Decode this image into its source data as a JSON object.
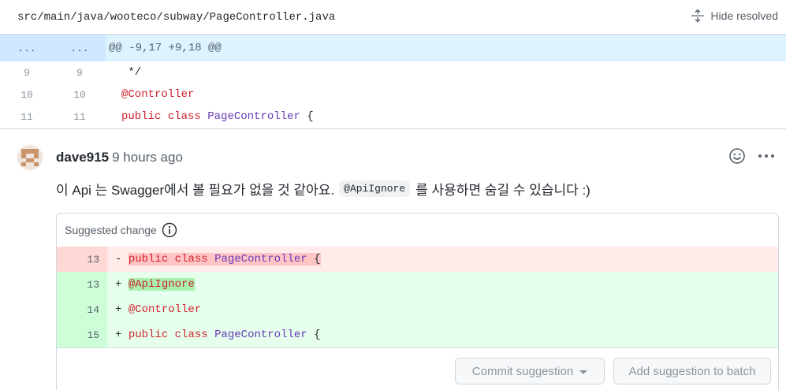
{
  "file": {
    "path": "src/main/java/wooteco/subway/PageController.java",
    "hide_resolved_label": "Hide resolved"
  },
  "diff": {
    "hunk": {
      "left": "...",
      "right": "...",
      "header": "@@ -9,17 +9,18 @@"
    },
    "lines": [
      {
        "old": "9",
        "new": "9",
        "code": " */"
      },
      {
        "old": "10",
        "new": "10",
        "code_ann": "@Controller"
      },
      {
        "old": "11",
        "new": "11",
        "kw1": "public",
        "kw2": "class",
        "cls": "PageController",
        "rest": " {"
      }
    ]
  },
  "comment": {
    "author": "dave915",
    "time": "9 hours ago",
    "text_before": "이 Api 는 Swagger에서 볼 필요가 없을 것 같아요.",
    "inline_code": "@ApiIgnore",
    "text_after": "를 사용하면 숨길 수 있습니다 :)"
  },
  "suggestion": {
    "title": "Suggested change",
    "rows": [
      {
        "type": "del",
        "num": "13",
        "sign": "-",
        "parts": [
          "public",
          "class",
          "PageController",
          " {"
        ]
      },
      {
        "type": "add",
        "num": "13",
        "sign": "+",
        "text": "@ApiIgnore"
      },
      {
        "type": "add",
        "num": "14",
        "sign": "+",
        "text": "@Controller"
      },
      {
        "type": "add",
        "num": "15",
        "sign": "+",
        "parts": [
          "public",
          "class",
          "PageController",
          " {"
        ]
      }
    ],
    "commit_label": "Commit suggestion",
    "batch_label": "Add suggestion to batch"
  },
  "colors": {
    "accent_blue_hunk": "#ddf4ff",
    "del_bg": "#ffebe9",
    "add_bg": "#e6ffec",
    "keyword": "#cf222e",
    "class_name": "#6639ba"
  },
  "icons": {
    "hide_resolved": "unfold-icon",
    "reaction": "smiley-icon",
    "menu": "kebab-horizontal-icon",
    "info": "info-icon"
  }
}
